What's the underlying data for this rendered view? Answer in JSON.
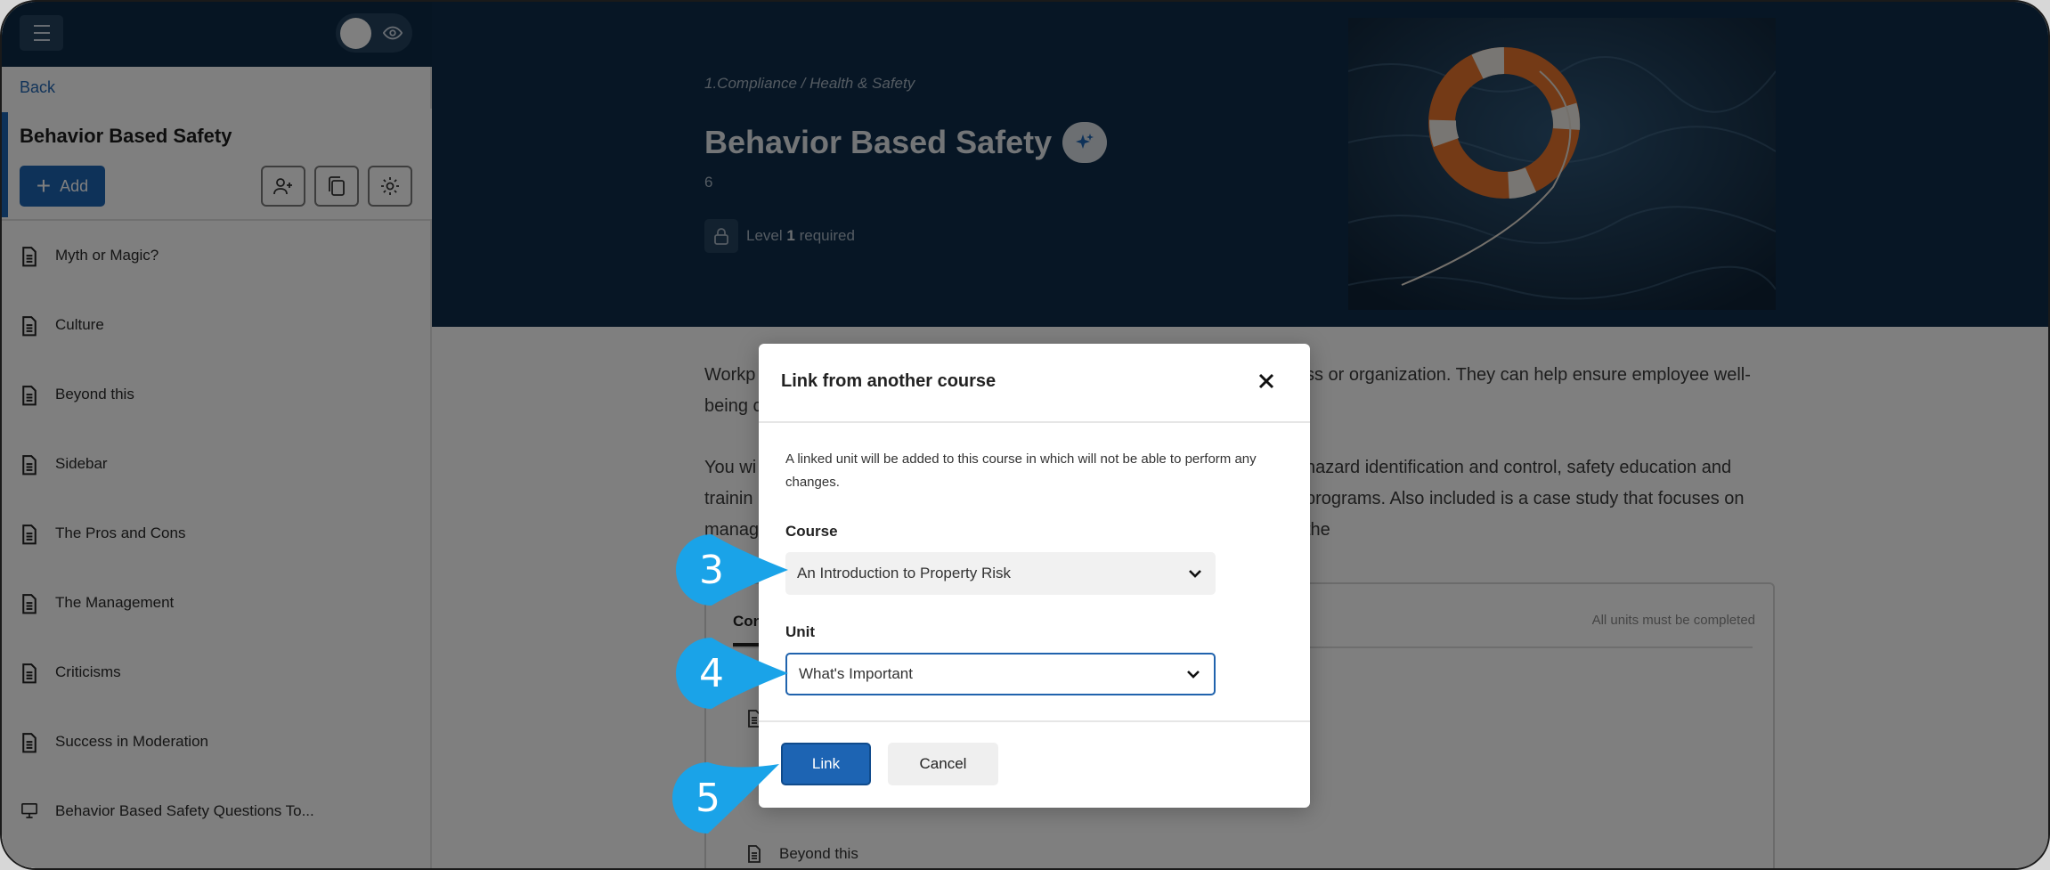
{
  "sidebar": {
    "back_label": "Back",
    "course_title": "Behavior Based Safety",
    "add_label": "Add",
    "items": [
      {
        "label": "Myth or Magic?",
        "icon": "document-icon"
      },
      {
        "label": "Culture",
        "icon": "document-icon"
      },
      {
        "label": "Beyond this",
        "icon": "document-icon"
      },
      {
        "label": "Sidebar",
        "icon": "document-icon"
      },
      {
        "label": "The Pros and Cons",
        "icon": "document-icon"
      },
      {
        "label": "The Management",
        "icon": "document-icon"
      },
      {
        "label": "Criticisms",
        "icon": "document-icon"
      },
      {
        "label": "Success in Moderation",
        "icon": "document-icon"
      },
      {
        "label": "Behavior Based Safety Questions To...",
        "icon": "presentation-icon"
      }
    ]
  },
  "hero": {
    "breadcrumb": "1.Compliance / Health & Safety",
    "title": "Behavior Based Safety",
    "count": "6",
    "level_prefix": "Level",
    "level_number": "1",
    "level_suffix": "required"
  },
  "body": {
    "para1_line1_left": "Workp",
    "para1_line1_right": "ss or organization. They can help ensure employee well-",
    "para1_line2_left": "being c",
    "para2_line1_left": "You wi",
    "para2_line1_right": "hazard identification and control, safety education and",
    "para2_line2_left": "trainin",
    "para2_line2_right": "programs. Also included is a case study that focuses on the",
    "para2_line3_left": "manag"
  },
  "card": {
    "tab_label": "Con",
    "note": "All units must be completed",
    "last_item": "Beyond this"
  },
  "modal": {
    "title": "Link from another course",
    "description": "A linked unit will be added to this course in which will not be able to perform any changes.",
    "course_label": "Course",
    "course_value": "An Introduction to Property Risk",
    "unit_label": "Unit",
    "unit_value": "What's Important",
    "link_label": "Link",
    "cancel_label": "Cancel"
  },
  "callouts": [
    "3",
    "4",
    "5"
  ],
  "colors": {
    "brand_navy": "#0e2d4a",
    "primary_blue": "#1d64b3",
    "callout_blue": "#1aa3e8"
  }
}
